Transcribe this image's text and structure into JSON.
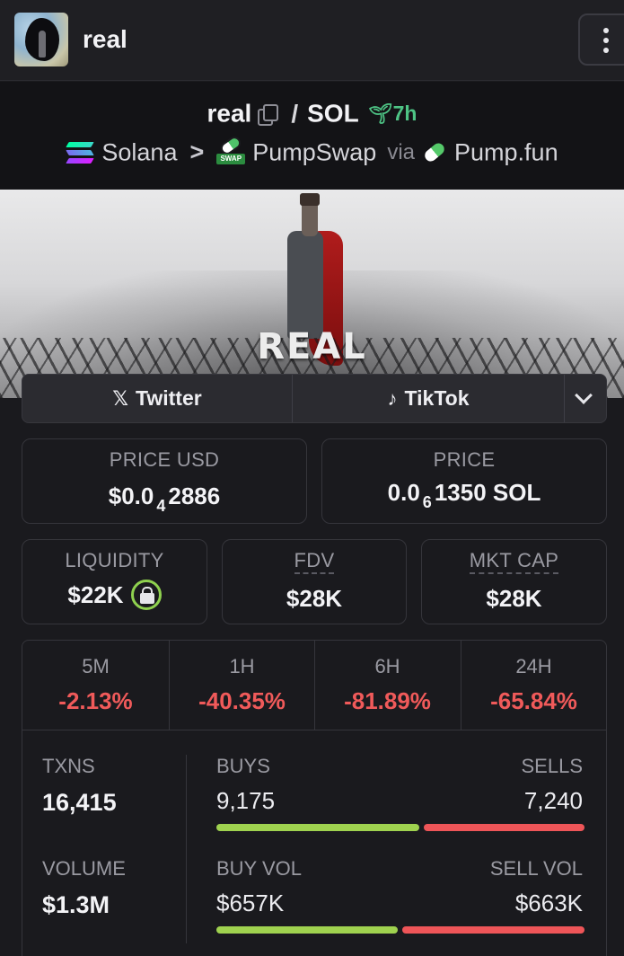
{
  "header": {
    "token_name": "real"
  },
  "pair": {
    "base": "real",
    "separator": "/",
    "quote": "SOL",
    "age": "7h",
    "chain": "Solana",
    "dex": "PumpSwap",
    "via_label": "via",
    "launchpad": "Pump.fun",
    "dex_icon_text": "SWAP"
  },
  "banner": {
    "title": "REAL"
  },
  "socials": {
    "twitter_label": "Twitter",
    "tiktok_label": "TikTok",
    "twitter_icon": "x-logo-icon",
    "tiktok_icon": "tiktok-logo-icon"
  },
  "stats": {
    "price_usd": {
      "label": "PRICE USD",
      "prefix": "$0.0",
      "zeros": "4",
      "digits": "2886"
    },
    "price_native": {
      "label": "PRICE",
      "prefix": "0.0",
      "zeros": "6",
      "digits": "1350",
      "unit": "SOL"
    },
    "liquidity": {
      "label": "LIQUIDITY",
      "value": "$22K",
      "locked": true
    },
    "fdv": {
      "label": "FDV",
      "value": "$28K"
    },
    "mkt_cap": {
      "label": "MKT CAP",
      "value": "$28K"
    }
  },
  "changes": [
    {
      "label": "5M",
      "value": "-2.13%"
    },
    {
      "label": "1H",
      "value": "-40.35%"
    },
    {
      "label": "6H",
      "value": "-81.89%"
    },
    {
      "label": "24H",
      "value": "-65.84%"
    }
  ],
  "txns": {
    "txns_label": "TXNS",
    "txns_value": "16,415",
    "buys_label": "BUYS",
    "buys_value": "9,175",
    "sells_label": "SELLS",
    "sells_value": "7,240",
    "buys_fraction": 0.559,
    "volume_label": "VOLUME",
    "volume_value": "$1.3M",
    "buy_vol_label": "BUY VOL",
    "buy_vol_value": "$657K",
    "sell_vol_label": "SELL VOL",
    "sell_vol_value": "$663K",
    "buy_vol_fraction": 0.498
  },
  "colors": {
    "negative": "#f05a5a",
    "positive_age": "#4ec485",
    "buy_bar": "#9fd24f",
    "sell_bar": "#ee5558",
    "lock_ring": "#8fd14f"
  }
}
